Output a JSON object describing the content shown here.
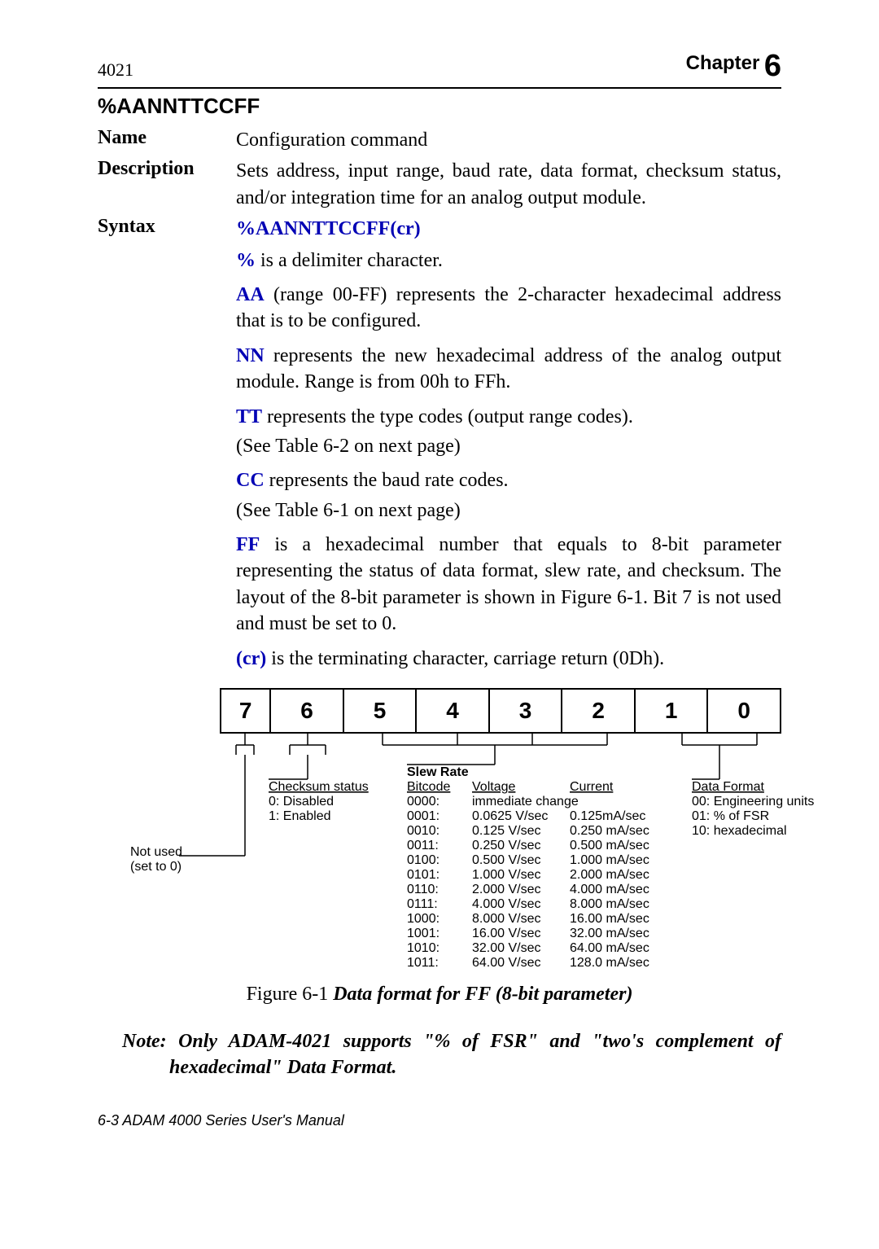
{
  "header": {
    "left": "4021",
    "chapter_word": "Chapter",
    "chapter_num": "6"
  },
  "section_title": "%AANNTTCCFF",
  "name_label": "Name",
  "name_value": "Configuration command",
  "desc_label": "Description",
  "desc_value": "Sets address, input range, baud rate, data format, checksum status, and/or integration time for an analog output module.",
  "syntax_label": "Syntax",
  "syntax_token": "%AANNTTCCFF(cr)",
  "p_delim_pre": "%",
  "p_delim_post": " is a delimiter character.",
  "p_aa_pre": "AA",
  "p_aa_post": " (range 00-FF) represents the 2-character hexadecimal address that is to be configured.",
  "p_nn_pre": "NN",
  "p_nn_post": " represents the new hexadecimal address of the analog output module. Range is from 00h to FFh.",
  "p_tt_pre": "TT",
  "p_tt_post": " represents the type codes (output range codes).",
  "p_tt_see": "(See Table 6-2 on next page)",
  "p_cc_pre": "CC",
  "p_cc_post": " represents the baud rate codes.",
  "p_cc_see": "(See Table 6-1 on next page)",
  "p_ff_pre": "FF",
  "p_ff_post": " is a hexadecimal number that equals to 8-bit parameter representing the status of data format, slew rate, and checksum. The layout of the 8-bit parameter is shown in Figure 6-1. Bit 7 is not used and must be set to 0.",
  "p_cr_pre": "(cr)",
  "p_cr_post": " is the terminating character, carriage return (0Dh).",
  "bits": {
    "b7": "7",
    "b6": "6",
    "b5": "5",
    "b4": "4",
    "b3": "3",
    "b2": "2",
    "b1": "1",
    "b0": "0"
  },
  "diagram": {
    "not_used_l1": "Not used",
    "not_used_l2": "(set to 0)",
    "checksum_head": "Checksum status",
    "checksum_0": "0: Disabled",
    "checksum_1": "1: Enabled",
    "slew_head": "Slew Rate",
    "bitcode_head": "Bitcode",
    "voltage_head": "Voltage",
    "current_head": "Current",
    "bitcodes": [
      "0000:",
      "0001:",
      "0010:",
      "0011:",
      "0100:",
      "0101:",
      "0110:",
      "0111:",
      "1000:",
      "1001:",
      "1010:",
      "1011:"
    ],
    "volt0": "immediate change",
    "voltages": [
      "0.0625 V/sec",
      "0.125 V/sec",
      "0.250 V/sec",
      "0.500 V/sec",
      "1.000 V/sec",
      "2.000 V/sec",
      "4.000 V/sec",
      "8.000 V/sec",
      "16.00 V/sec",
      "32.00 V/sec",
      "64.00 V/sec"
    ],
    "currents": [
      "0.125mA/sec",
      "0.250 mA/sec",
      "0.500 mA/sec",
      "1.000 mA/sec",
      "2.000 mA/sec",
      "4.000 mA/sec",
      "8.000 mA/sec",
      "16.00 mA/sec",
      "32.00 mA/sec",
      "64.00 mA/sec",
      "128.0 mA/sec"
    ],
    "df_head": "Data Format",
    "df_0": "00: Engineering units",
    "df_1": "01: % of FSR",
    "df_2": "10: hexadecimal"
  },
  "fig_cap_pre": "Figure 6-1 ",
  "fig_cap_em": "Data format for FF (8-bit parameter)",
  "note": "Note: Only ADAM-4021 supports \"% of FSR\" and \"two's complement of hexadecimal\" Data Format.",
  "footer": "6-3 ADAM 4000 Series User's Manual"
}
